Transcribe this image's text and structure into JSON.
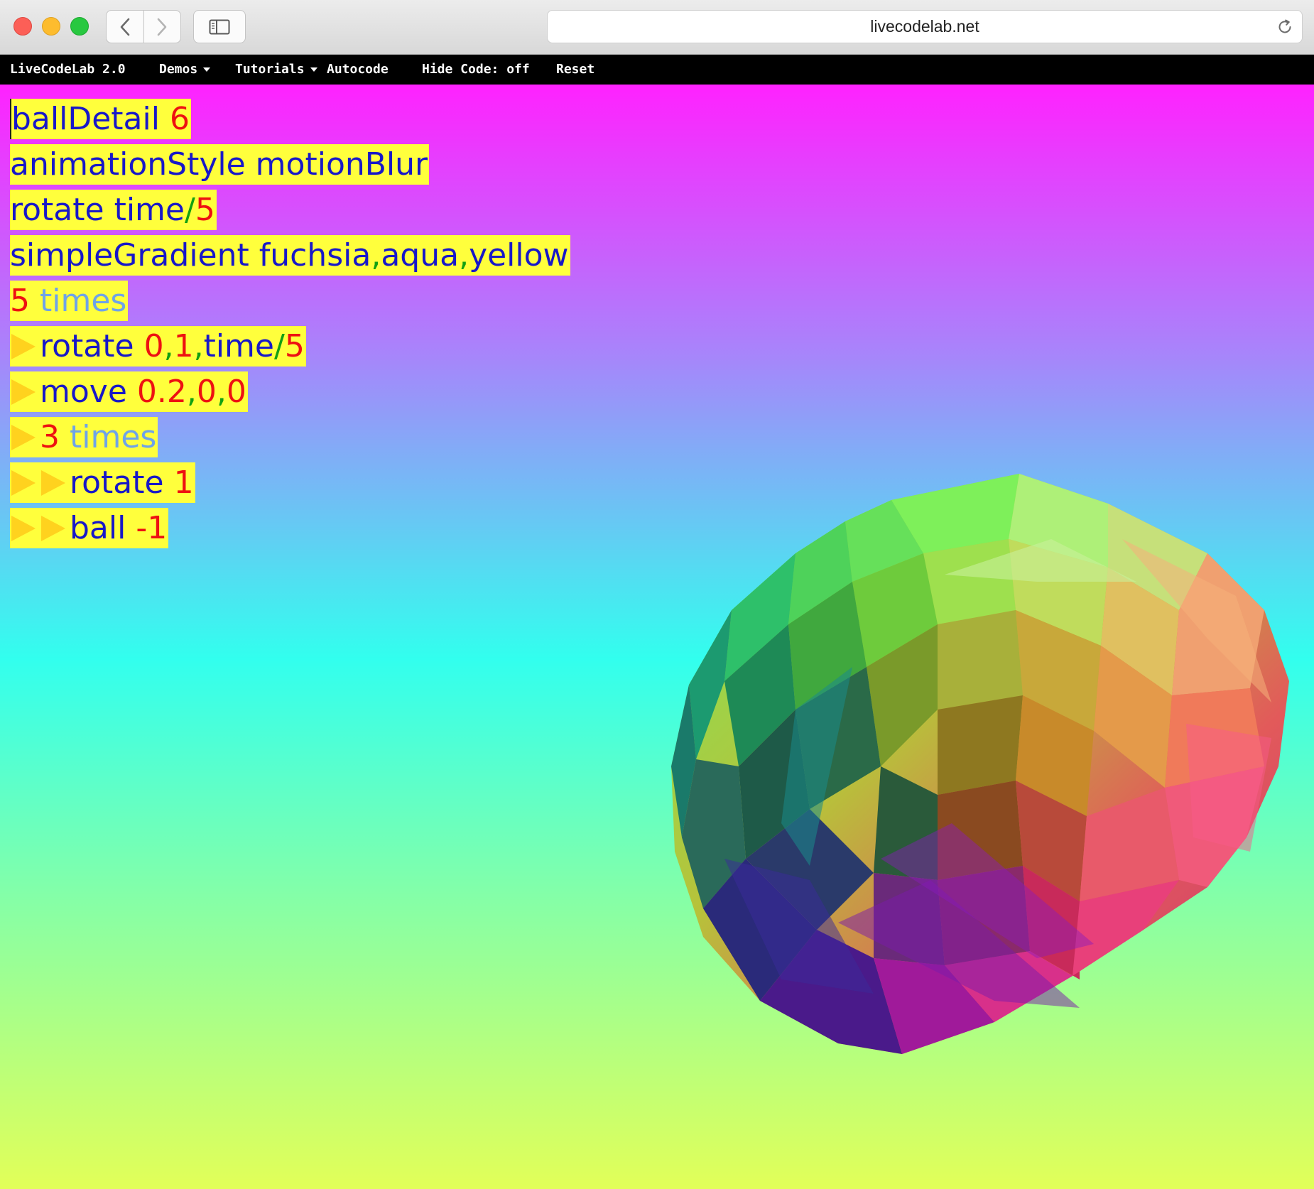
{
  "browser": {
    "url": "livecodelab.net",
    "icons": {
      "back": "chevron-left-icon",
      "forward": "chevron-right-icon",
      "sidebar": "sidebar-icon",
      "reload": "reload-icon"
    }
  },
  "menu": {
    "brand": "LiveCodeLab 2.0",
    "demos": "Demos",
    "tutorials": "Tutorials",
    "autocode": "Autocode",
    "hide_code": "Hide Code: off",
    "reset": "Reset"
  },
  "gradient": {
    "colors": [
      "#ff22ff",
      "#32ffee",
      "#e2ff58"
    ]
  },
  "code_lines": [
    {
      "indent": 0,
      "tokens": [
        {
          "t": "ballDetail ",
          "c": "kw"
        },
        {
          "t": "6",
          "c": "num"
        }
      ]
    },
    {
      "indent": 0,
      "tokens": [
        {
          "t": "animationStyle motionBlur",
          "c": "kw"
        }
      ]
    },
    {
      "indent": 0,
      "tokens": [
        {
          "t": "rotate time",
          "c": "kw"
        },
        {
          "t": "/",
          "c": "op"
        },
        {
          "t": "5",
          "c": "num"
        }
      ]
    },
    {
      "indent": 0,
      "tokens": [
        {
          "t": "simpleGradient fuchsia",
          "c": "kw"
        },
        {
          "t": ",",
          "c": "op"
        },
        {
          "t": "aqua",
          "c": "kw"
        },
        {
          "t": ",",
          "c": "op"
        },
        {
          "t": "yellow",
          "c": "kw"
        }
      ]
    },
    {
      "indent": 0,
      "tokens": [
        {
          "t": "5",
          "c": "num"
        },
        {
          "t": " times",
          "c": "loop"
        }
      ]
    },
    {
      "indent": 1,
      "tokens": [
        {
          "t": "rotate ",
          "c": "kw"
        },
        {
          "t": "0",
          "c": "num"
        },
        {
          "t": ",",
          "c": "op"
        },
        {
          "t": "1",
          "c": "num"
        },
        {
          "t": ",",
          "c": "op"
        },
        {
          "t": "time",
          "c": "kw"
        },
        {
          "t": "/",
          "c": "op"
        },
        {
          "t": "5",
          "c": "num"
        }
      ]
    },
    {
      "indent": 1,
      "tokens": [
        {
          "t": "move ",
          "c": "kw"
        },
        {
          "t": "0.2",
          "c": "num"
        },
        {
          "t": ",",
          "c": "op"
        },
        {
          "t": "0",
          "c": "num"
        },
        {
          "t": ",",
          "c": "op"
        },
        {
          "t": "0",
          "c": "num"
        }
      ]
    },
    {
      "indent": 1,
      "tokens": [
        {
          "t": "3",
          "c": "num"
        },
        {
          "t": " times",
          "c": "loop"
        }
      ]
    },
    {
      "indent": 2,
      "tokens": [
        {
          "t": "rotate ",
          "c": "kw"
        },
        {
          "t": "1",
          "c": "num"
        }
      ]
    },
    {
      "indent": 2,
      "tokens": [
        {
          "t": "ball ",
          "c": "kw"
        },
        {
          "t": "-1",
          "c": "num"
        }
      ]
    }
  ]
}
